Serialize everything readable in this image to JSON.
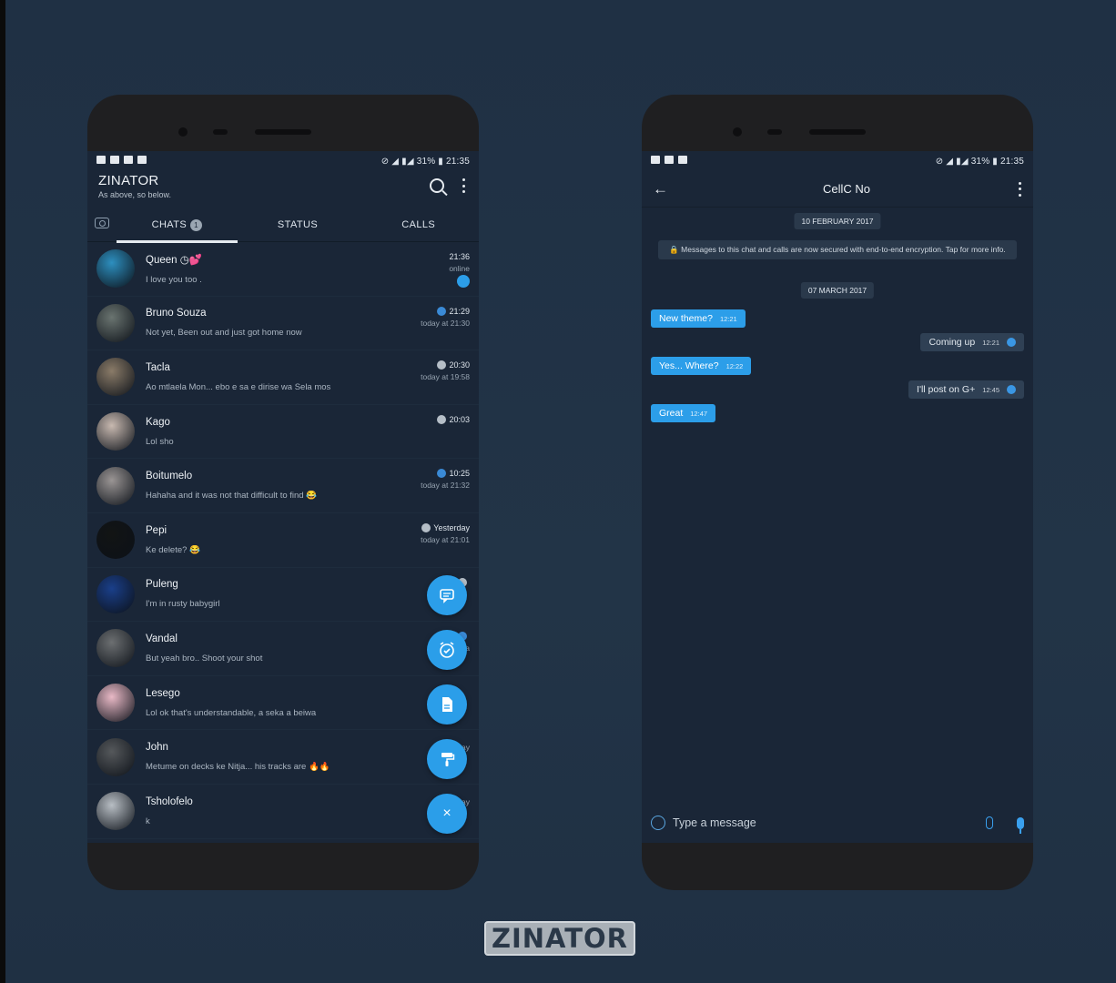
{
  "left_phone": {
    "status_right": "⊘ ◢ ▮◢ 31% ▮ 21:35",
    "app_title": "ZINATOR",
    "app_subtitle": "As above, so below.",
    "tabs": [
      {
        "label": "CHATS",
        "badge": "1"
      },
      {
        "label": "STATUS"
      },
      {
        "label": "CALLS"
      }
    ],
    "chats": [
      {
        "name": "Queen ◷💕",
        "message": "I love you too .",
        "time": "21:36",
        "sub": "online",
        "tick": "unread",
        "color": "#2d8fbf"
      },
      {
        "name": "Bruno Souza",
        "message": "Not yet, Been out and just got home now",
        "time": "21:29",
        "sub": "today at 21:30",
        "tick": "blue",
        "color": "#6a7470"
      },
      {
        "name": "Tacla",
        "message": "Ao mtlaela Mon... ebo e sa e dirise wa Sela mos",
        "time": "20:30",
        "sub": "today at 19:58",
        "tick": "grey",
        "color": "#8a7b68"
      },
      {
        "name": "Kago",
        "message": "Lol sho",
        "time": "20:03",
        "sub": "",
        "tick": "grey",
        "color": "#c8b9b0"
      },
      {
        "name": "Boitumelo",
        "message": "Hahaha and it was not that difficult to find 😂",
        "time": "10:25",
        "sub": "today at 21:32",
        "tick": "blue",
        "color": "#9a9594"
      },
      {
        "name": "Pepi",
        "message": "Ke delete? 😂",
        "time": "Yesterday",
        "sub": "today at 21:01",
        "tick": "grey",
        "color": "#121414"
      },
      {
        "name": "Puleng",
        "message": "I'm in rusty babygirl",
        "time": "",
        "sub": "",
        "tick": "grey",
        "color": "#1a3f8a"
      },
      {
        "name": "Vandal",
        "message": "But yeah bro.. Shoot your shot",
        "time": "",
        "sub": "toda",
        "tick": "blue",
        "color": "#6c6f71"
      },
      {
        "name": "Lesego",
        "message": "Lol ok that's understandable, a seka a beiwa",
        "time": "",
        "sub": "",
        "tick": "",
        "color": "#e9b9c6"
      },
      {
        "name": "John",
        "message": "Metume on decks ke Nitja... his tracks are 🔥🔥",
        "time": "",
        "sub": "today",
        "tick": "",
        "color": "#55585b"
      },
      {
        "name": "Tsholofelo",
        "message": "k",
        "time": "",
        "sub": "yesterday",
        "tick": "",
        "color": "#b8bec4"
      }
    ],
    "fabs": [
      "chat-bubble-icon",
      "alarm-icon",
      "document-icon",
      "paint-roller-icon",
      "close-icon"
    ],
    "fab_close_glyph": "×"
  },
  "right_phone": {
    "status_right": "⊘ ◢ ▮◢ 31% ▮ 21:35",
    "chat_title": "CellC No",
    "date_1": "10 FEBRUARY 2017",
    "encryption_notice": "🔒 Messages to this chat and calls are now secured with end-to-end encryption. Tap for more info.",
    "date_2": "07 MARCH 2017",
    "messages": [
      {
        "dir": "in",
        "text": "New theme?",
        "time": "12:21"
      },
      {
        "dir": "out",
        "text": "Coming up",
        "time": "12:21"
      },
      {
        "dir": "in",
        "text": "Yes... Where?",
        "time": "12:22"
      },
      {
        "dir": "out",
        "text": "I'll post on G+",
        "time": "12:45"
      },
      {
        "dir": "in",
        "text": "Great",
        "time": "12:47"
      }
    ],
    "composer_placeholder": "Type a message"
  },
  "brand_logo": "ZINATOR",
  "colors": {
    "accent": "#2b9ee9",
    "background": "#1f3044",
    "screen": "#1a2637"
  }
}
